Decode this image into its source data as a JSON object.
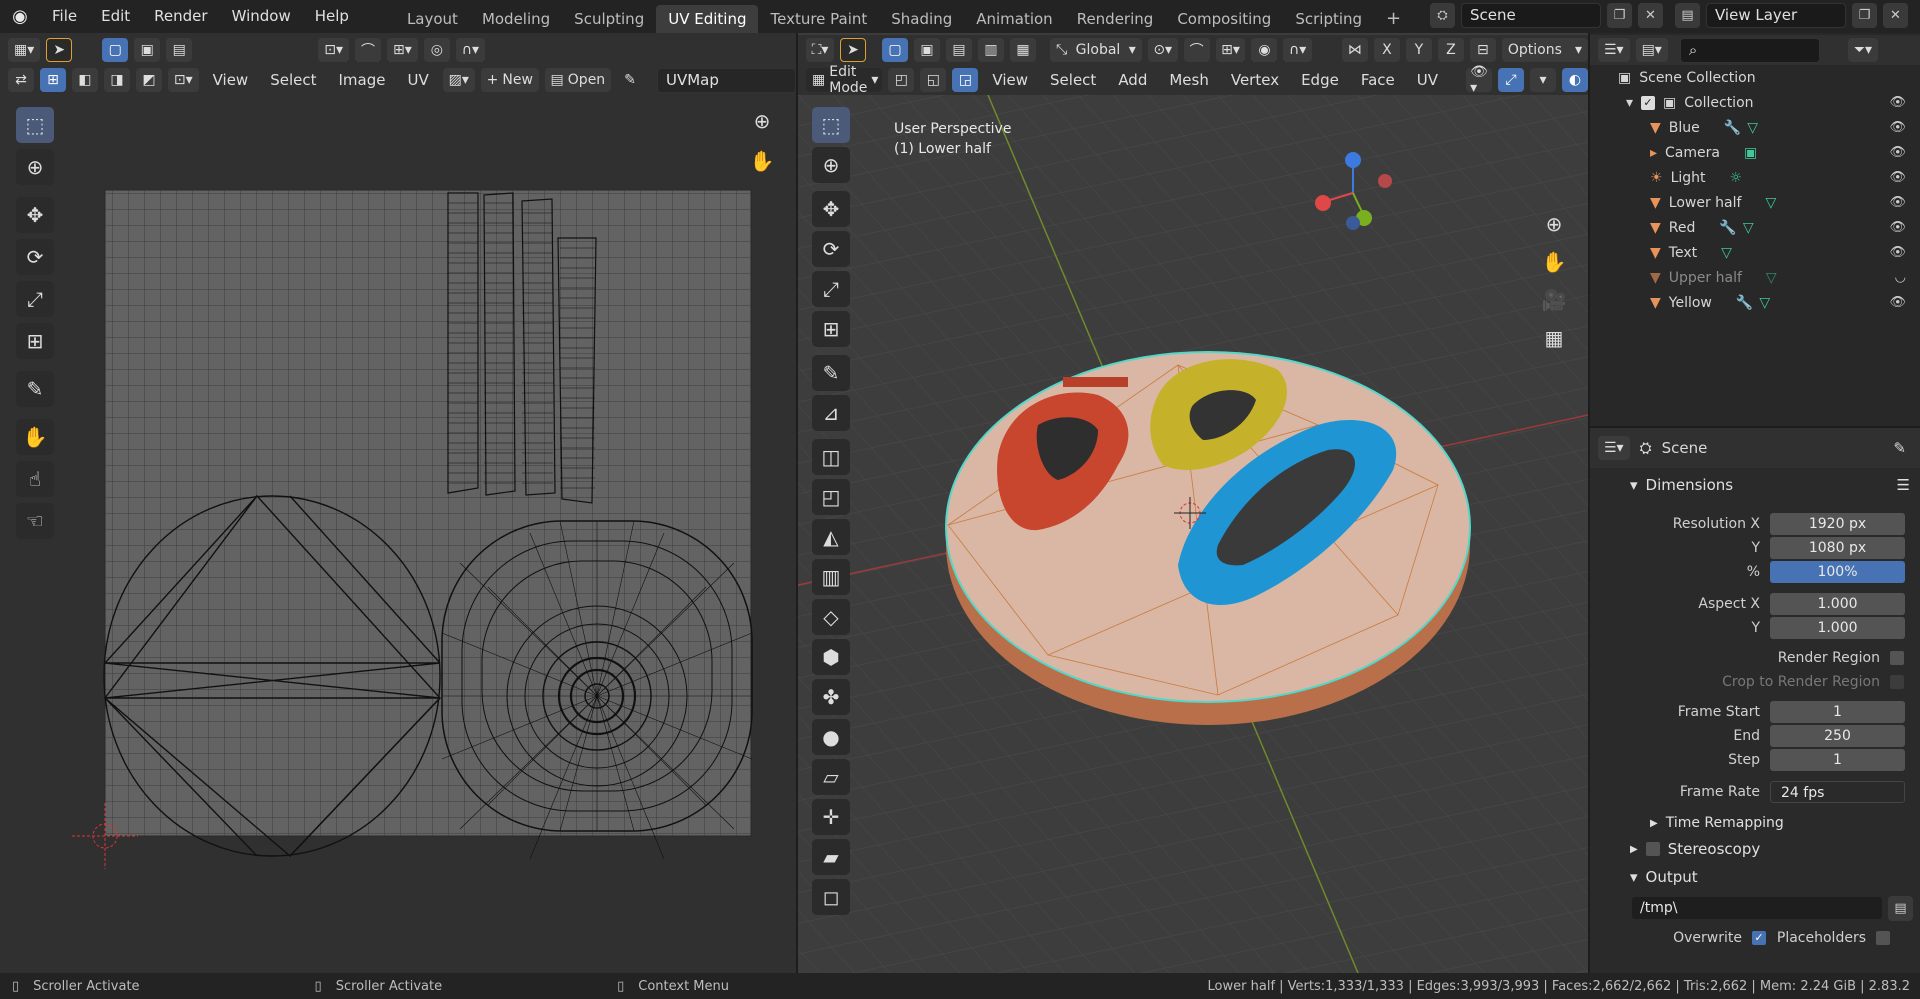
{
  "menu": [
    "File",
    "Edit",
    "Render",
    "Window",
    "Help"
  ],
  "workspaces": [
    "Layout",
    "Modeling",
    "Sculpting",
    "UV Editing",
    "Texture Paint",
    "Shading",
    "Animation",
    "Rendering",
    "Compositing",
    "Scripting"
  ],
  "active_workspace": "UV Editing",
  "scene_name": "Scene",
  "view_layer": "View Layer",
  "uv_editor": {
    "menus": [
      "View",
      "Select",
      "Image",
      "UV"
    ],
    "new_label": "New",
    "open_label": "Open",
    "uvmap": "UVMap"
  },
  "viewport": {
    "transform": "Global",
    "options": "Options",
    "mode": "Edit Mode",
    "menus": [
      "View",
      "Select",
      "Add",
      "Mesh",
      "Vertex",
      "Edge",
      "Face",
      "UV"
    ],
    "perspective": "User Perspective",
    "object_label": "(1) Lower half",
    "axes": [
      "X",
      "Y",
      "Z"
    ]
  },
  "outliner": {
    "root": "Scene Collection",
    "collection": "Collection",
    "items": [
      "Blue",
      "Camera",
      "Light",
      "Lower half",
      "Red",
      "Text",
      "Upper half",
      "Yellow"
    ]
  },
  "properties": {
    "scene": "Scene",
    "dimensions": "Dimensions",
    "res_x_label": "Resolution X",
    "res_x": "1920 px",
    "res_y_label": "Y",
    "res_y": "1080 px",
    "pct_label": "%",
    "pct": "100%",
    "aspect_x_label": "Aspect X",
    "aspect_x": "1.000",
    "aspect_y_label": "Y",
    "aspect_y": "1.000",
    "render_region": "Render Region",
    "crop": "Crop to Render Region",
    "frame_start_label": "Frame Start",
    "frame_start": "1",
    "end_label": "End",
    "end": "250",
    "step_label": "Step",
    "step": "1",
    "frame_rate_label": "Frame Rate",
    "frame_rate": "24 fps",
    "time_remap": "Time Remapping",
    "stereoscopy": "Stereoscopy",
    "output": "Output",
    "path": "/tmp\\",
    "overwrite": "Overwrite",
    "placeholders": "Placeholders"
  },
  "status": {
    "a": "Scroller Activate",
    "b": "Scroller Activate",
    "c": "Context Menu",
    "info": "Lower half | Verts:1,333/1,333 | Edges:3,993/3,993 | Faces:2,662/2,662 | Tris:2,662 | Mem: 2.24 GiB | 2.83.2"
  }
}
